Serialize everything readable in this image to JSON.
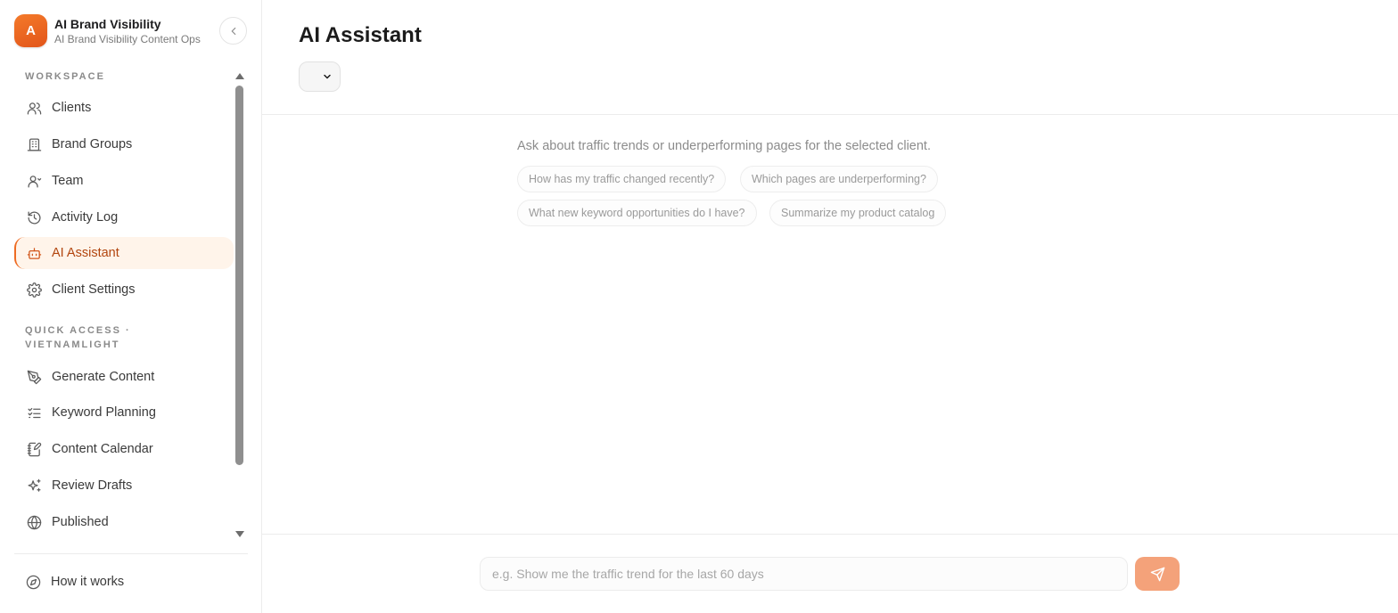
{
  "brand": {
    "logo_letter": "A",
    "name": "AI Brand Visibility",
    "subtitle": "AI Brand Visibility Content Ops"
  },
  "sidebar": {
    "workspace_label": "WORKSPACE",
    "workspace_items": [
      {
        "label": "Clients",
        "icon": "users-icon"
      },
      {
        "label": "Brand Groups",
        "icon": "building-icon"
      },
      {
        "label": "Team",
        "icon": "user-icon"
      },
      {
        "label": "Activity Log",
        "icon": "history-icon"
      },
      {
        "label": "AI Assistant",
        "icon": "bot-icon",
        "active": true
      },
      {
        "label": "Client Settings",
        "icon": "gear-icon"
      }
    ],
    "quick_access_label_line1": "QUICK ACCESS ·",
    "quick_access_label_line2": "VIETNAMLIGHT",
    "quick_access_items": [
      {
        "label": "Generate Content",
        "icon": "pen-tool-icon"
      },
      {
        "label": "Keyword Planning",
        "icon": "list-checks-icon"
      },
      {
        "label": "Content Calendar",
        "icon": "notebook-pen-icon"
      },
      {
        "label": "Review Drafts",
        "icon": "sparkles-icon"
      },
      {
        "label": "Published",
        "icon": "globe-icon"
      }
    ],
    "footer_item": {
      "label": "How it works",
      "icon": "compass-icon"
    }
  },
  "main": {
    "title": "AI Assistant",
    "client_select_value": "",
    "empty_prompt": "Ask about traffic trends or underperforming pages for the selected client.",
    "suggestions": [
      "How has my traffic changed recently?",
      "Which pages are underperforming?",
      "What new keyword opportunities do I have?",
      "Summarize my product catalog"
    ],
    "input_placeholder": "e.g. Show me the traffic trend for the last 60 days",
    "send_icon": "send-icon"
  },
  "colors": {
    "accent": "#ee6b22",
    "active_bg": "#fff4ea",
    "active_text": "#b2450e",
    "send_button": "#f4a27a"
  }
}
